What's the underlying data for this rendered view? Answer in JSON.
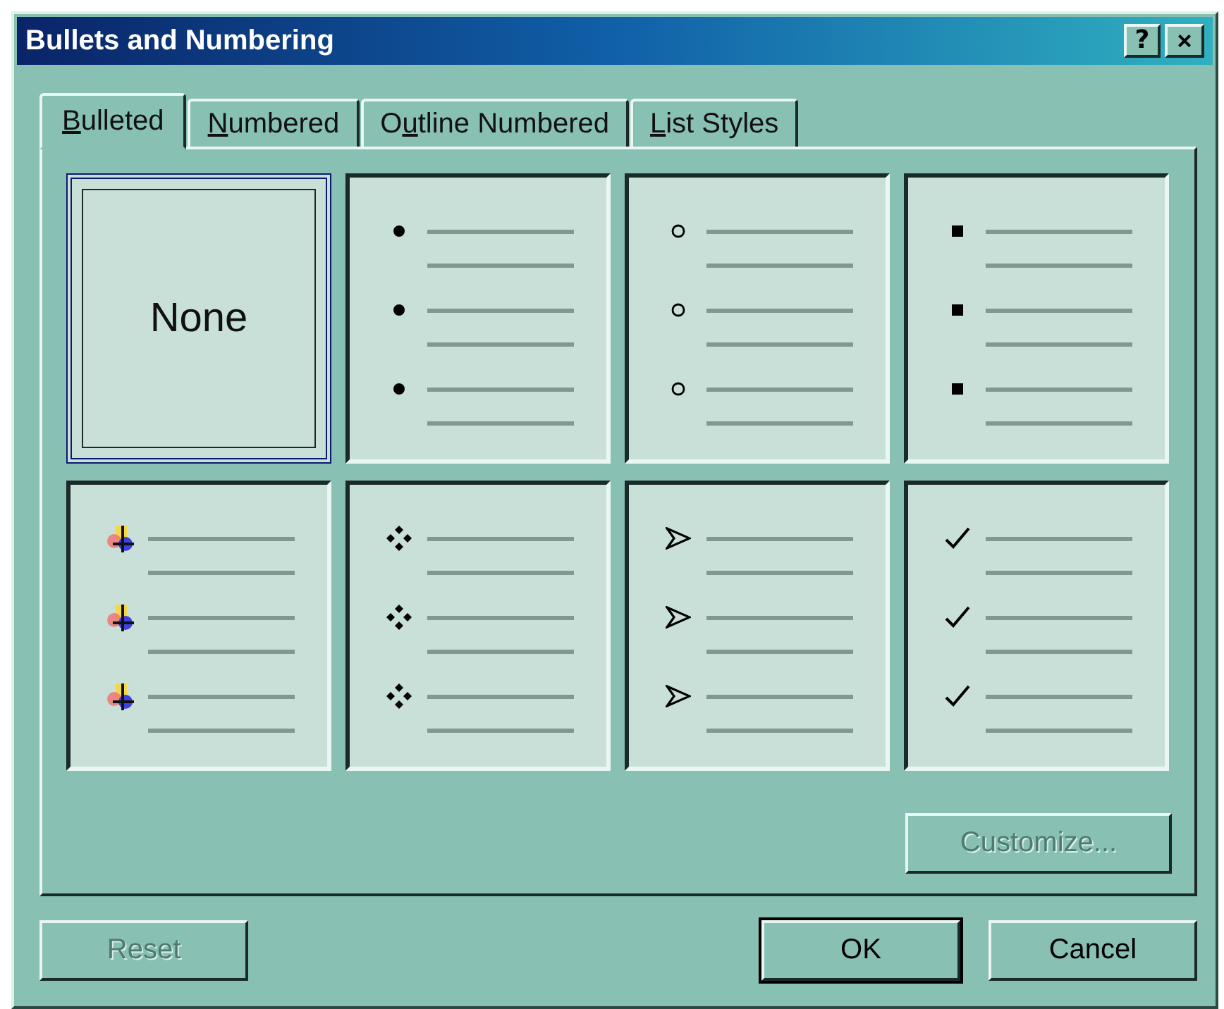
{
  "window": {
    "title": "Bullets and Numbering",
    "title_buttons": [
      {
        "kind": "help",
        "label": "?"
      },
      {
        "kind": "close",
        "label": "×"
      }
    ]
  },
  "tabs": [
    {
      "key": "B",
      "after": "ulleted",
      "selected": true
    },
    {
      "key": "N",
      "after": "umbered",
      "selected": false
    },
    {
      "before": "O",
      "key": "u",
      "after": "tline Numbered",
      "selected": false
    },
    {
      "key": "L",
      "after": "ist Styles",
      "selected": false
    }
  ],
  "styles": [
    {
      "kind": "none",
      "label": "None",
      "selected": true
    },
    {
      "kind": "dot",
      "selected": false
    },
    {
      "kind": "circle",
      "selected": false
    },
    {
      "kind": "square",
      "selected": false
    },
    {
      "kind": "picture",
      "selected": false
    },
    {
      "kind": "diamonds",
      "selected": false
    },
    {
      "kind": "arrow",
      "selected": false
    },
    {
      "kind": "check",
      "selected": false
    }
  ],
  "customize_button": {
    "label": "Customize...",
    "disabled": true
  },
  "buttons": [
    {
      "label": "Reset",
      "disabled": true,
      "default": false
    },
    {
      "label": "OK",
      "disabled": false,
      "default": true
    },
    {
      "label": "Cancel",
      "disabled": false,
      "default": false
    }
  ]
}
